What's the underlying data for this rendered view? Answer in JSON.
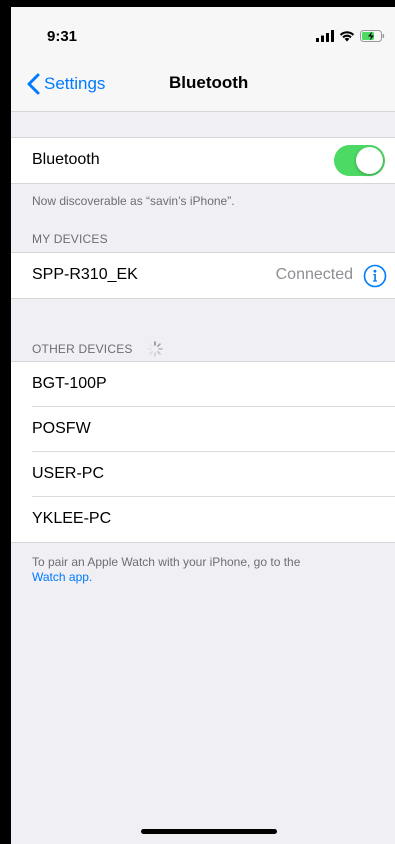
{
  "status_bar": {
    "time": "9:31",
    "icons": [
      "signal-bars-icon",
      "wifi-icon",
      "battery-charging-icon"
    ]
  },
  "nav": {
    "back_label": "Settings",
    "title": "Bluetooth"
  },
  "bluetooth_toggle": {
    "label": "Bluetooth",
    "on": true,
    "on_color": "#4cd964"
  },
  "discoverable_text": "Now discoverable as “savin’s iPhone”.",
  "my_devices": {
    "header": "MY DEVICES",
    "items": [
      {
        "name": "SPP-R310_EK",
        "status": "Connected"
      }
    ]
  },
  "other_devices": {
    "header": "OTHER DEVICES",
    "items": [
      {
        "name": "BGT-100P"
      },
      {
        "name": "POSFW"
      },
      {
        "name": "USER-PC"
      },
      {
        "name": "YKLEE-PC"
      }
    ]
  },
  "footer": {
    "text": "To pair an Apple Watch with your iPhone, go to the",
    "link": "Watch app."
  },
  "colors": {
    "accent": "#007aff",
    "background": "#efeff4",
    "secondary_text": "#6d6d72"
  }
}
